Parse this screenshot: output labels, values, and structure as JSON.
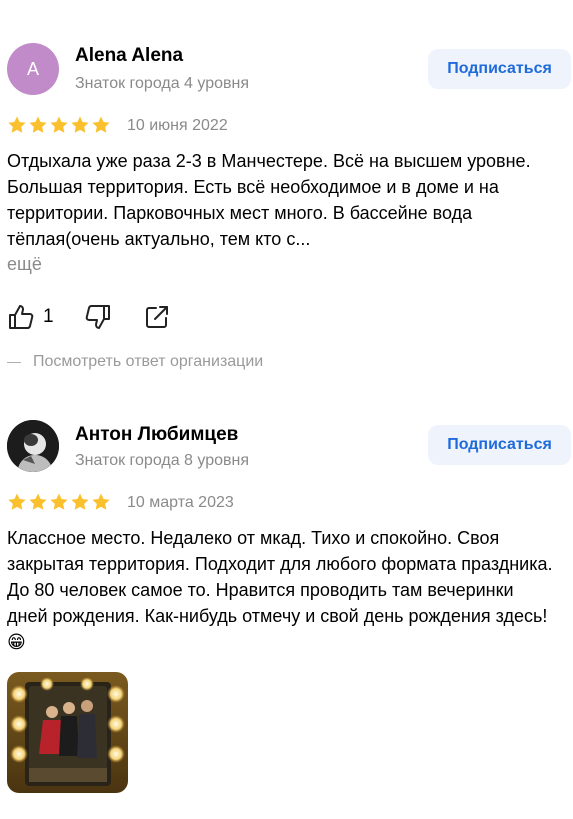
{
  "reviews": [
    {
      "avatar_letter": "A",
      "avatar_color": "#c18bc9",
      "author": "Alena Alena",
      "level": "Знаток города 4 уровня",
      "subscribe_label": "Подписаться",
      "rating": 5,
      "date": "10 июня 2022",
      "text": "Отдыхала уже раза 2-3 в Манчестере. Всё на высшем уровне. Большая территория. Есть всё необходимое и в доме и на территории. Парковочных мест много. В бассейне вода тёплая(очень актуально, тем кто с...",
      "more_label": "ещё",
      "likes": "1",
      "org_reply_label": "Посмотреть ответ организации"
    },
    {
      "avatar_icon": "user-photo",
      "author": "Антон Любимцев",
      "level": "Знаток города 8 уровня",
      "subscribe_label": "Подписаться",
      "rating": 5,
      "date": "10 марта 2023",
      "text": "Классное место. Недалеко от мкад. Тихо и спокойно. Своя закрытая территория. Подходит для любого формата праздника. До 80 человек самое то. Нравится проводить там вечеринки дней рождения. Как-нибудь отмечу и свой день рождения здесь!😁"
    }
  ],
  "colors": {
    "star": "#fbc02d",
    "accent": "#1f6bdc",
    "subscribe_bg": "#eef3fc",
    "secondary_text": "#8a8a8a"
  }
}
